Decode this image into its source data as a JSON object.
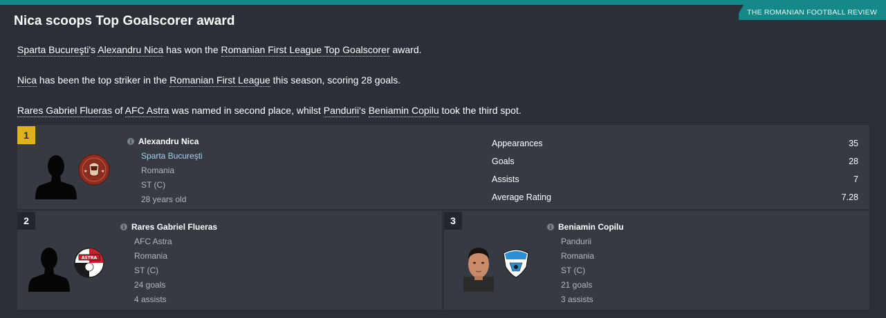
{
  "source": "THE ROMANIAN FOOTBALL REVIEW",
  "headline": "Nica scoops Top Goalscorer award",
  "paragraphs": {
    "p1": {
      "club": "Sparta Bucureşti",
      "club_suffix": "'s ",
      "player": "Alexandru Nica",
      "mid": " has won the ",
      "award": "Romanian First League Top Goalscorer",
      "end": " award."
    },
    "p2": {
      "player": "Nica",
      "mid": " has been the top striker in the ",
      "league": "Romanian First League",
      "end": " this season, scoring 28 goals."
    },
    "p3": {
      "second": "Rares Gabriel Flueras",
      "of": " of ",
      "second_club": "AFC Astra",
      "mid": " was named in second place, whilst ",
      "third_club": "Pandurii",
      "possessive": "'s ",
      "third": "Beniamin Copilu",
      "end": " took the third spot."
    }
  },
  "winners": [
    {
      "rank": "1",
      "name": "Alexandru Nica",
      "club": "Sparta Bucureşti",
      "nation": "Romania",
      "position": "ST (C)",
      "age": "28 years old",
      "badge_color": "#9c3322",
      "badge_text": "SPARTA",
      "badge_sub": "BUCUREŞTI",
      "stats": [
        {
          "label": "Appearances",
          "value": "35"
        },
        {
          "label": "Goals",
          "value": "28"
        },
        {
          "label": "Assists",
          "value": "7"
        },
        {
          "label": "Average Rating",
          "value": "7.28"
        }
      ]
    },
    {
      "rank": "2",
      "name": "Rares Gabriel Flueras",
      "club": "AFC Astra",
      "nation": "Romania",
      "position": "ST (C)",
      "goals": "24 goals",
      "assists": "4 assists",
      "badge_text": "ASTRA",
      "badge_color": "#c8202a"
    },
    {
      "rank": "3",
      "name": "Beniamin Copilu",
      "club": "Pandurii",
      "nation": "Romania",
      "position": "ST (C)",
      "goals": "21 goals",
      "assists": "3 assists",
      "badge_color": "#2b8fd6"
    }
  ],
  "icons": {
    "info": "info-icon",
    "player_photo": "player-silhouette-icon"
  }
}
